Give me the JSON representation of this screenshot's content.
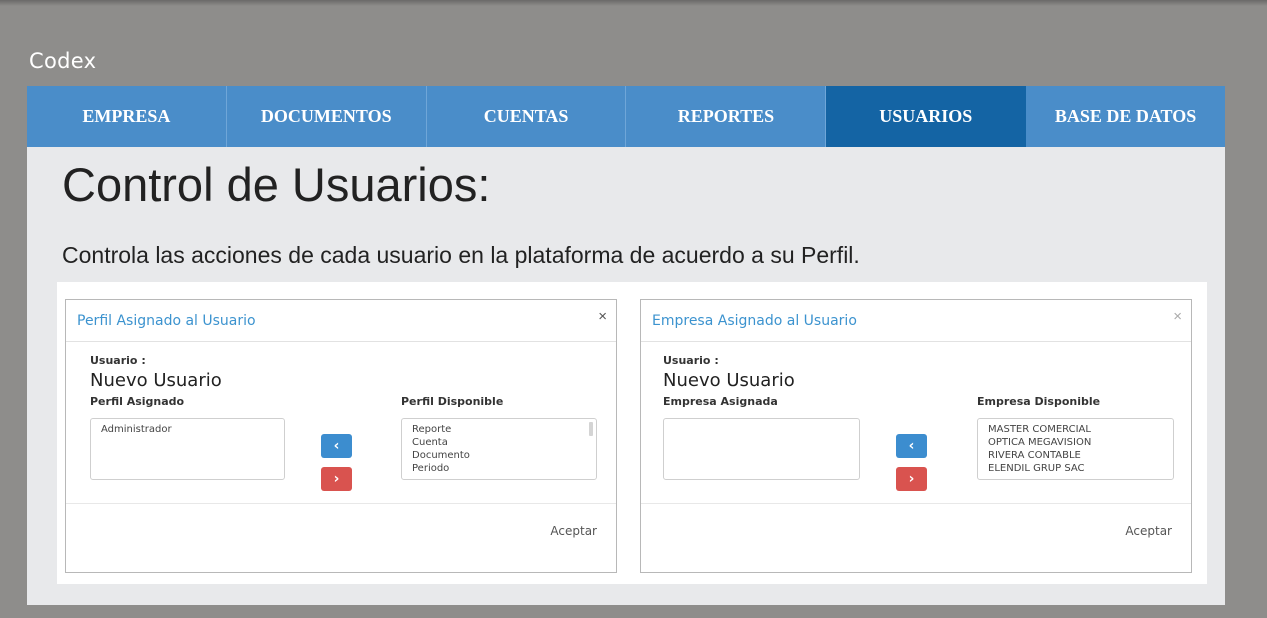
{
  "app": {
    "title": "Codex"
  },
  "nav": {
    "tabs": [
      {
        "label": "EMPRESA"
      },
      {
        "label": "DOCUMENTOS"
      },
      {
        "label": "CUENTAS"
      },
      {
        "label": "REPORTES"
      },
      {
        "label": "USUARIOS",
        "active": true
      },
      {
        "label": "BASE DE DATOS"
      }
    ]
  },
  "page": {
    "heading": "Control de Usuarios:",
    "description": "Controla las acciones de cada usuario en la plataforma de acuerdo a su Perfil."
  },
  "dialog_perfil": {
    "title": "Perfil Asignado al Usuario",
    "close": "×",
    "user_label": "Usuario :",
    "user_value": "Nuevo Usuario",
    "assigned_label": "Perfil Asignado",
    "available_label": "Perfil Disponible",
    "assigned_items": [
      "Administrador"
    ],
    "available_items": [
      "Reporte",
      "Cuenta",
      "Documento",
      "Periodo"
    ],
    "btn_left": "‹",
    "btn_right": "›",
    "accept_label": "Aceptar"
  },
  "dialog_empresa": {
    "title": "Empresa Asignado al Usuario",
    "close": "×",
    "user_label": "Usuario :",
    "user_value": "Nuevo Usuario",
    "assigned_label": "Empresa Asignada",
    "available_label": "Empresa Disponible",
    "assigned_items": [],
    "available_items": [
      "MASTER COMERCIAL",
      "OPTICA MEGAVISION",
      "RIVERA CONTABLE",
      "ELENDIL GRUP SAC"
    ],
    "btn_left": "‹",
    "btn_right": "›",
    "accept_label": "Aceptar"
  },
  "colors": {
    "nav_bg": "#4a8dc9",
    "nav_active": "#1464a4",
    "btn_blue": "#3c8dcf",
    "btn_red": "#d9534f",
    "dialog_title": "#3c93cf"
  }
}
